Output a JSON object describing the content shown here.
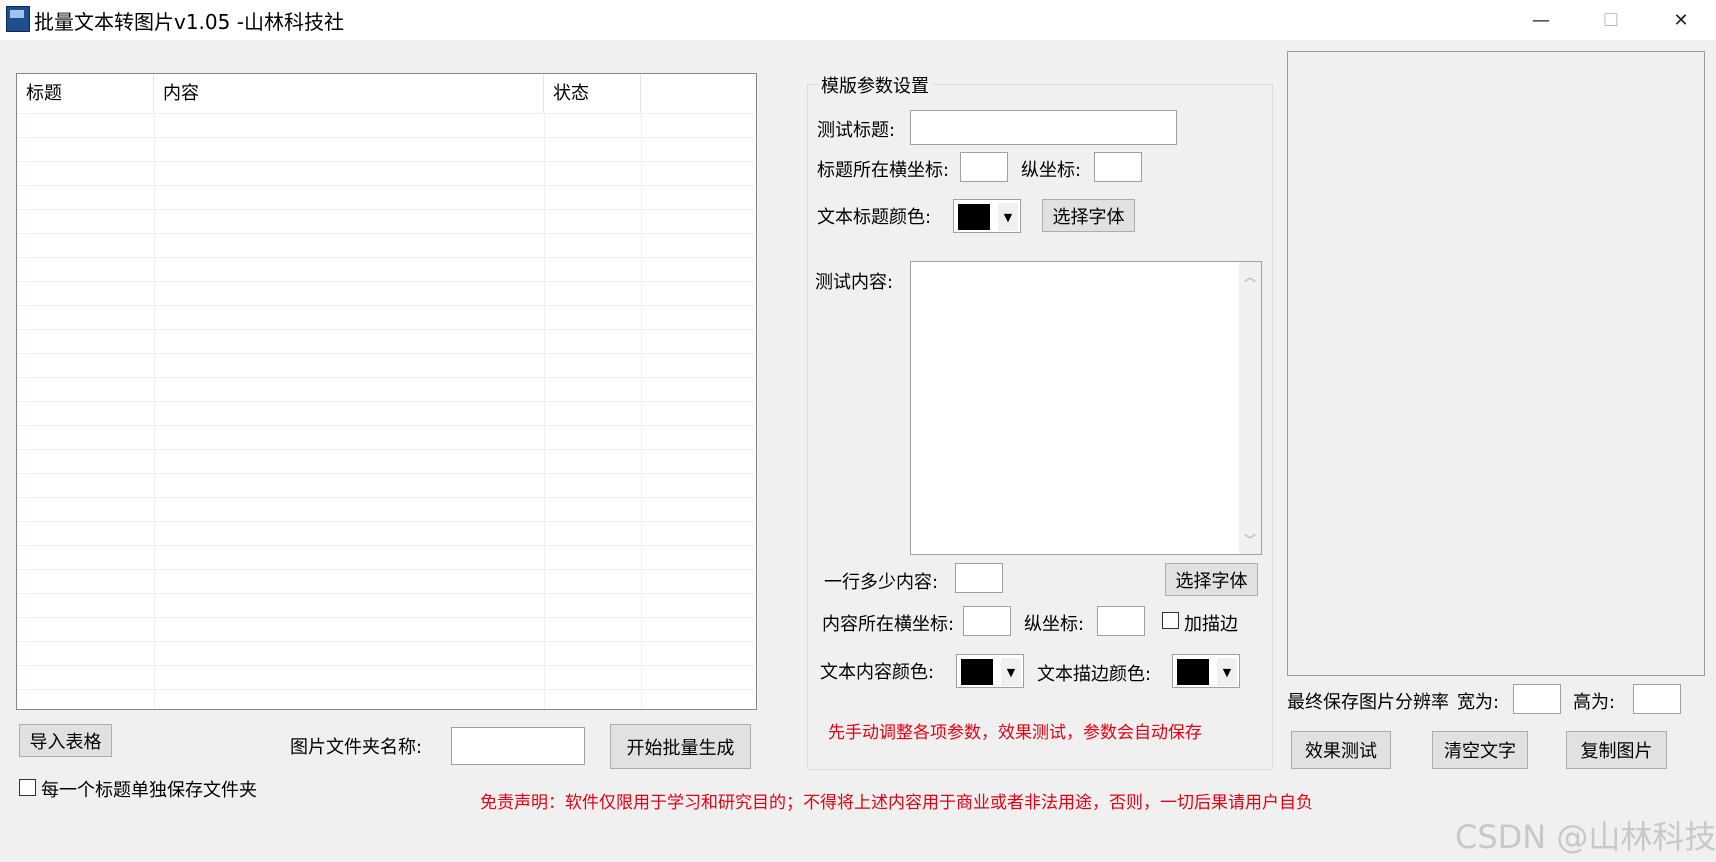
{
  "window": {
    "title": "批量文本转图片v1.05 -山林科技社",
    "minimize_glyph": "—",
    "maximize_glyph": "☐",
    "close_glyph": "✕"
  },
  "table": {
    "columns": [
      "标题",
      "内容",
      "状态"
    ]
  },
  "left_bottom": {
    "import_button": "导入表格",
    "folder_label": "图片文件夹名称:",
    "folder_value": "",
    "start_button": "开始批量生成",
    "separate_folder_checkbox": "每一个标题单独保存文件夹",
    "disclaimer": "免责声明：软件仅限用于学习和研究目的；不得将上述内容用于商业或者非法用途，否则，一切后果请用户自负"
  },
  "template": {
    "group_title": "模版参数设置",
    "test_title_label": "测试标题:",
    "test_title_value": "",
    "title_x_label": "标题所在横坐标:",
    "title_y_label": "纵坐标:",
    "title_color_label": "文本标题颜色:",
    "title_color": "#000000",
    "title_font_button": "选择字体",
    "test_content_label": "测试内容:",
    "test_content_value": "",
    "per_line_label": "一行多少内容:",
    "content_font_button": "选择字体",
    "content_x_label": "内容所在横坐标:",
    "content_y_label": "纵坐标:",
    "stroke_checkbox": "加描边",
    "content_color_label": "文本内容颜色:",
    "content_color": "#000000",
    "stroke_color_label": "文本描边颜色:",
    "stroke_color": "#000000",
    "hint": "先手动调整各项参数，效果测试，参数会自动保存"
  },
  "preview": {
    "resolution_label": "最终保存图片分辨率",
    "width_label": "宽为:",
    "height_label": "高为:",
    "test_button": "效果测试",
    "clear_button": "清空文字",
    "copy_button": "复制图片"
  },
  "watermark": "CSDN @山林科技"
}
